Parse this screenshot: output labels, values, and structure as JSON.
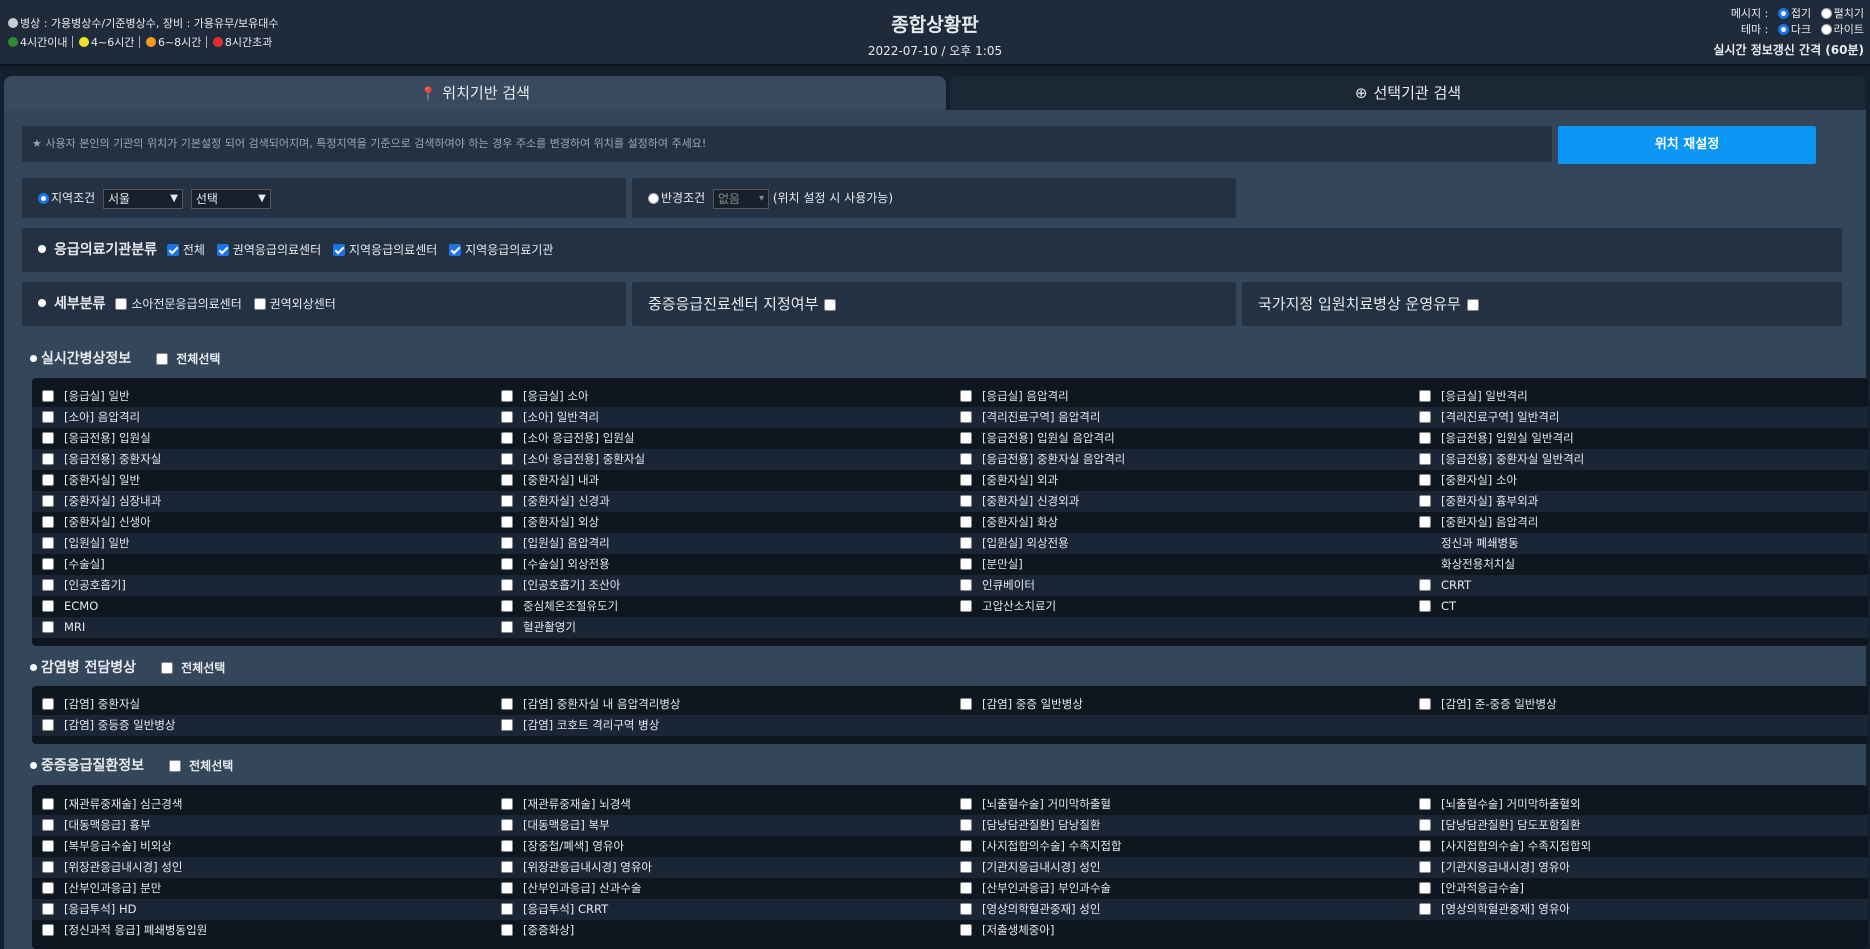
{
  "header": {
    "legend_title": "병상 : 가용병상수/기준병상수, 장비 : 가용유무/보유대수",
    "legend_items": [
      {
        "label": "4시간이내",
        "color": "#2e8b2e"
      },
      {
        "label": "4~6시간",
        "color": "#f2e22a"
      },
      {
        "label": "6~8시간",
        "color": "#f59a1b"
      },
      {
        "label": "8시간초과",
        "color": "#e03030"
      }
    ],
    "title": "종합상황판",
    "datetime": "2022-07-10 / 오후 1:05",
    "message_label": "메시지 :",
    "message_opt1": "접기",
    "message_opt2": "펼치기",
    "theme_label": "테마 :",
    "theme_opt1": "다크",
    "theme_opt2": "라이트",
    "refresh_text": "실시간 정보갱신 간격 (60분)"
  },
  "tabs": {
    "location": "위치기반 검색",
    "selected": "선택기관 검색"
  },
  "notice": "★ 사용자 본인의 기관의 위치가 기본설정 되어 검색되어지며, 특정지역을 기준으로 검색하여야 하는 경우 주소를 변경하여 위치를 설정하여 주세요!",
  "reset_button": "위치 재설정",
  "region": {
    "label": "지역조건",
    "city": "서울",
    "district": "선택"
  },
  "radius": {
    "label": "반경조건",
    "value": "없음",
    "note": "(위치 설정 시 사용가능)"
  },
  "classification": {
    "title": "응급의료기관분류",
    "options": [
      "전체",
      "권역응급의료센터",
      "지역응급의료센터",
      "지역응급의료기관"
    ]
  },
  "detail": {
    "title": "세부분류",
    "options": [
      "소아전문응급의료센터",
      "권역외상센터"
    ]
  },
  "severe_center": "중증응급진료센터 지정여부",
  "national": "국가지정 입원치료병상 운영유무",
  "select_all": "전체선택",
  "realtime": {
    "title": "실시간병상정보",
    "rows": [
      [
        "[응급실] 일반",
        "[응급실] 소아",
        "[응급실] 음압격리",
        "[응급실] 일반격리"
      ],
      [
        "[소아] 음압격리",
        "[소아] 일반격리",
        "[격리진료구역] 음압격리",
        "[격리진료구역] 일반격리"
      ],
      [
        "[응급전용] 입원실",
        "[소아 응급전용] 입원실",
        "[응급전용] 입원실 음압격리",
        "[응급전용] 입원실 일반격리"
      ],
      [
        "[응급전용] 중환자실",
        "[소아 응급전용] 중환자실",
        "[응급전용] 중환자실 음압격리",
        "[응급전용] 중환자실 일반격리"
      ],
      [
        "[중환자실] 일반",
        "[중환자실] 내과",
        "[중환자실] 외과",
        "[중환자실] 소아"
      ],
      [
        "[중환자실] 심장내과",
        "[중환자실] 신경과",
        "[중환자실] 신경외과",
        "[중환자실] 흉부외과"
      ],
      [
        "[중환자실] 신생아",
        "[중환자실] 외상",
        "[중환자실] 화상",
        "[중환자실] 음압격리"
      ],
      [
        "[입원실] 일반",
        "[입원실] 음압격리",
        "[입원실] 외상전용",
        "정신과 폐쇄병동"
      ],
      [
        "[수술실]",
        "[수술실] 외상전용",
        "[분만실]",
        "화상전용처치실"
      ],
      [
        "[인공호흡기]",
        "[인공호흡기] 조산아",
        "인큐베이터",
        "CRRT"
      ],
      [
        "ECMO",
        "중심체온조절유도기",
        "고압산소치료기",
        "CT"
      ],
      [
        "MRI",
        "혈관촬영기"
      ]
    ]
  },
  "infection": {
    "title": "감염병 전담병상",
    "rows": [
      [
        "[감염] 중환자실",
        "[감염] 중환자실 내 음압격리병상",
        "[감염] 중증 일반병상",
        "[감염] 준-중증 일반병상"
      ],
      [
        "[감염] 중등증 일반병상",
        "[감염] 코호트 격리구역 병상"
      ]
    ]
  },
  "severe": {
    "title": "중증응급질환정보",
    "rows": [
      [
        "[재관류중재술] 심근경색",
        "[재관류중재술] 뇌경색",
        "[뇌출혈수술] 거미막하출혈",
        "[뇌출혈수술] 거미막하출혈외"
      ],
      [
        "[대동맥응급] 흉부",
        "[대동맥응급] 복부",
        "[담낭담관질환] 담낭질환",
        "[담낭담관질환] 담도포함질환"
      ],
      [
        "[복부응급수술] 비외상",
        "[장중첩/폐색] 영유아",
        "[사지접합의수술] 수족지접합",
        "[사지접합의수술] 수족지접합외"
      ],
      [
        "[위장관응급내시경] 성인",
        "[위장관응급내시경] 영유아",
        "[기관지응급내시경] 성인",
        "[기관지응급내시경] 영유아"
      ],
      [
        "[산부인과응급] 분만",
        "[산부인과응급] 산과수술",
        "[산부인과응급] 부인과수술",
        "[안과적응급수술]"
      ],
      [
        "[응급투석] HD",
        "[응급투석] CRRT",
        "[영상의학혈관중재] 성인",
        "[영상의학혈관중재] 영유아"
      ],
      [
        "[정신과적 응급] 폐쇄병동입원",
        "[중증화상]",
        "[저출생체중아]"
      ]
    ]
  }
}
